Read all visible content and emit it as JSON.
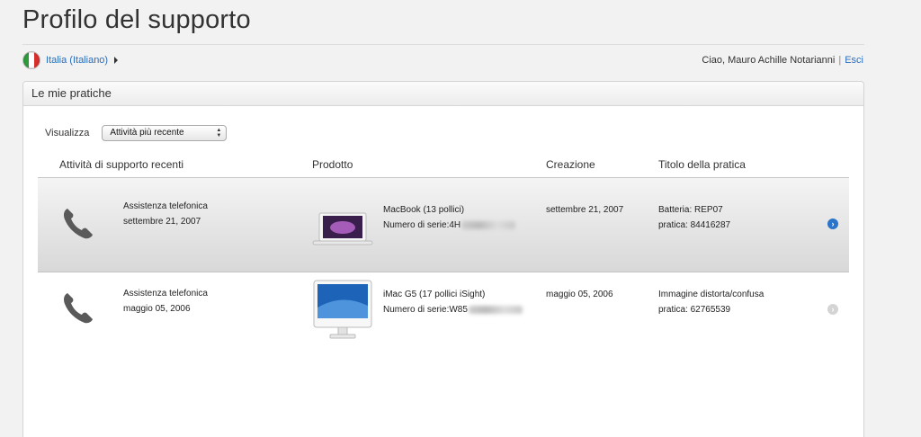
{
  "page": {
    "title": "Profilo del supporto"
  },
  "locale": {
    "label": "Italia (Italiano)"
  },
  "user": {
    "greeting": "Ciao, Mauro Achille Notarianni",
    "separator": "|",
    "logout": "Esci"
  },
  "panel": {
    "title": "Le mie pratiche",
    "filter_label": "Visualizza",
    "filter_value": "Attività più recente",
    "columns": {
      "activity": "Attività di supporto recenti",
      "product": "Prodotto",
      "created": "Creazione",
      "case_title": "Titolo della pratica"
    }
  },
  "cases": [
    {
      "activity_type": "Assistenza telefonica",
      "activity_date": "settembre 21, 2007",
      "product_name": "MacBook (13 pollici)",
      "serial_label": "Numero di serie:4H",
      "created": "settembre 21, 2007",
      "title": "Batteria: REP07",
      "case_number": "pratica: 84416287",
      "selected": true,
      "chevron_color": "#2a74c9"
    },
    {
      "activity_type": "Assistenza telefonica",
      "activity_date": "maggio 05, 2006",
      "product_name": "iMac G5 (17 pollici iSight)",
      "serial_label": "Numero di serie:W85",
      "created": "maggio 05, 2006",
      "title": "Immagine distorta/confusa",
      "case_number": "pratica: 62765539",
      "selected": false,
      "chevron_color": "#d4d4d4"
    }
  ]
}
